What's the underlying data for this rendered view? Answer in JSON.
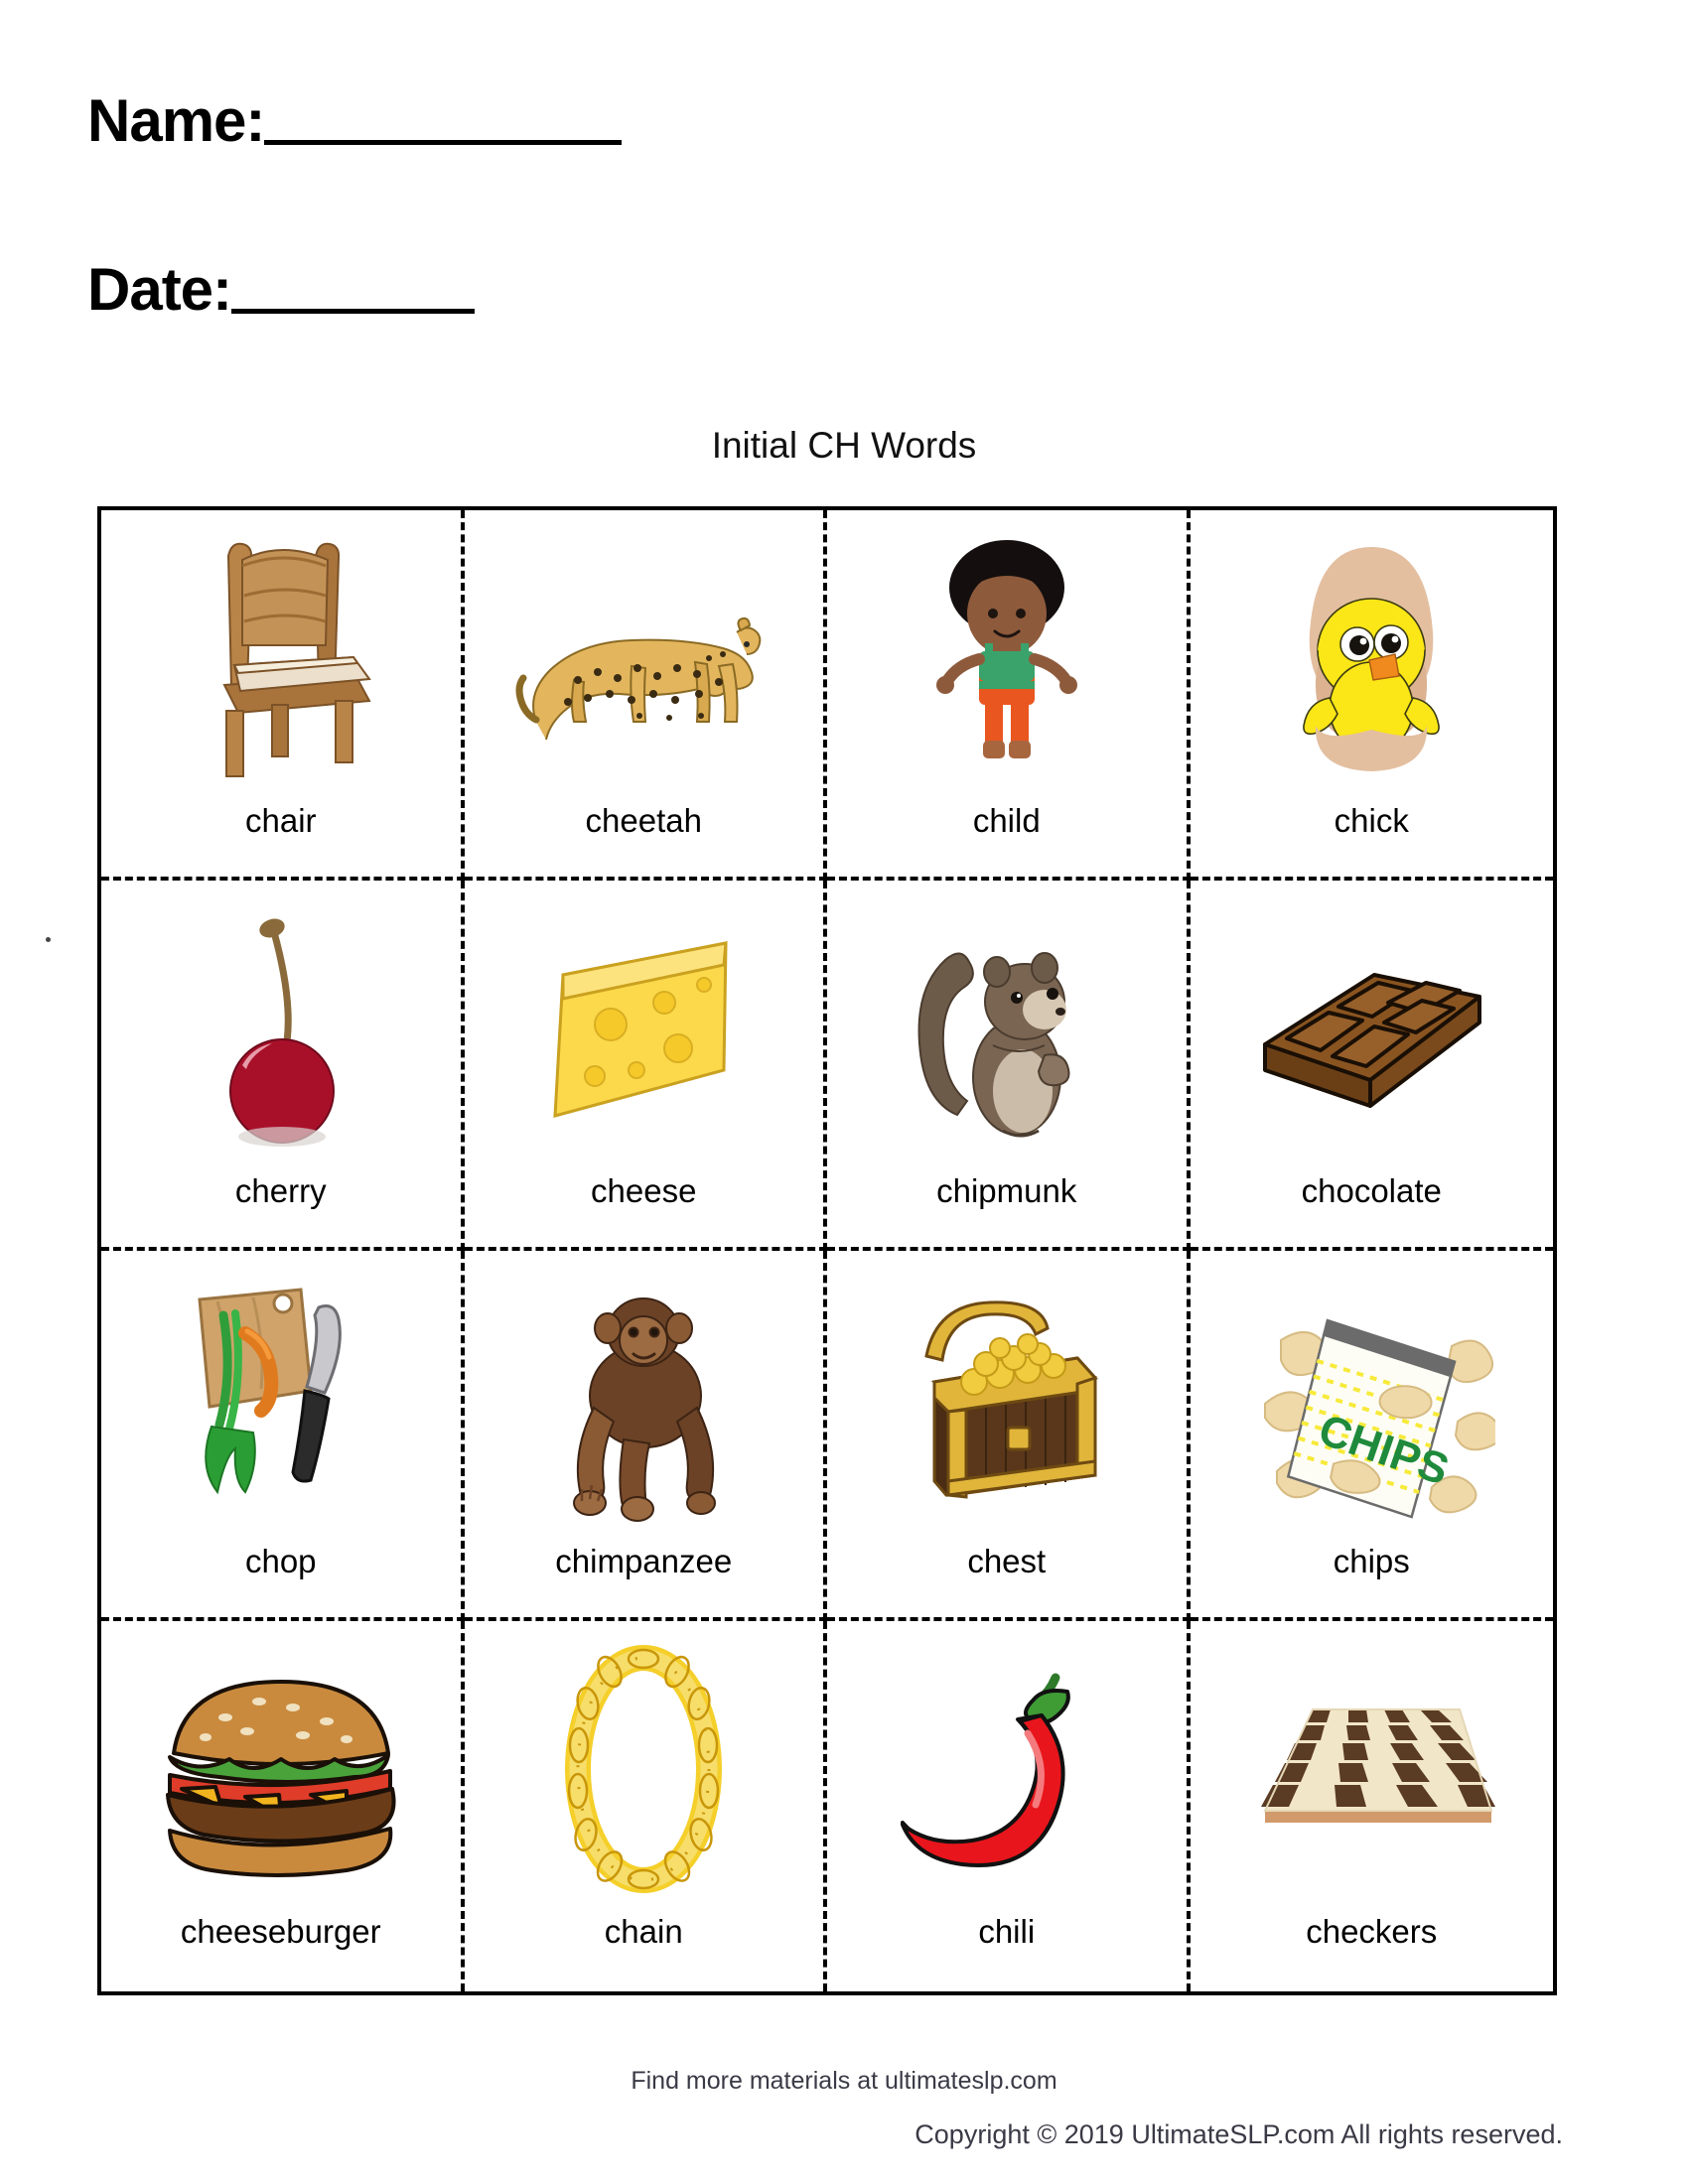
{
  "header": {
    "name_label": "Name:",
    "date_label": "Date:"
  },
  "title": "Initial CH Words",
  "grid": {
    "rows": 4,
    "columns": 4,
    "items": [
      {
        "label": "chair",
        "icon": "chair-image"
      },
      {
        "label": "cheetah",
        "icon": "cheetah-image"
      },
      {
        "label": "child",
        "icon": "child-image"
      },
      {
        "label": "chick",
        "icon": "chick-image"
      },
      {
        "label": "cherry",
        "icon": "cherry-image"
      },
      {
        "label": "cheese",
        "icon": "cheese-image"
      },
      {
        "label": "chipmunk",
        "icon": "chipmunk-image"
      },
      {
        "label": "chocolate",
        "icon": "chocolate-image"
      },
      {
        "label": "chop",
        "icon": "chop-image"
      },
      {
        "label": "chimpanzee",
        "icon": "chimpanzee-image"
      },
      {
        "label": "chest",
        "icon": "chest-image"
      },
      {
        "label": "chips",
        "icon": "chips-image"
      },
      {
        "label": "cheeseburger",
        "icon": "cheeseburger-image"
      },
      {
        "label": "chain",
        "icon": "chain-image"
      },
      {
        "label": "chili",
        "icon": "chili-image"
      },
      {
        "label": "checkers",
        "icon": "checkers-image"
      }
    ]
  },
  "art_text": {
    "chips_bag": "CHIPS"
  },
  "footer": {
    "find_more": "Find more materials at ultimateslp.com",
    "copyright": "Copyright © 2019 UltimateSLP.com All rights reserved."
  },
  "colors": {
    "ink": "#000000",
    "footer_text": "#3a3a46",
    "wood": "#a9763f",
    "wood_dark": "#8a5c2e",
    "cushion": "#ece0cc",
    "cheetah": "#e8bf6b",
    "cherry_red": "#a8102a",
    "cheese_yellow": "#fbd94b",
    "chocolate_brown": "#8a5420",
    "chips_green": "#1f8a3c",
    "chili_red": "#e8161c",
    "gold": "#f5c518",
    "checker_dark": "#5a3b23",
    "checker_light": "#f2e6c8"
  }
}
